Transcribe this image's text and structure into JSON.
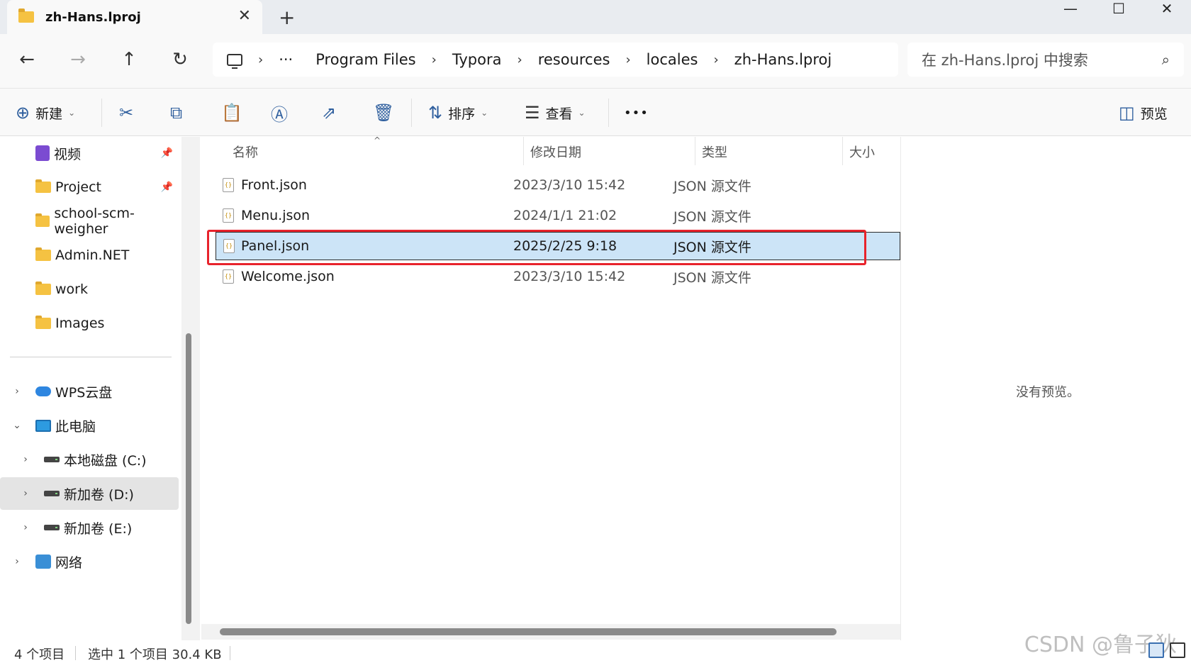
{
  "window": {
    "tab_title": "zh-Hans.lproj",
    "close_tab": "✕",
    "new_tab": "+",
    "minimize": "—",
    "maximize": "☐",
    "close": "✕"
  },
  "nav": {
    "back": "←",
    "forward": "→",
    "up": "↑",
    "refresh": "↻"
  },
  "address": {
    "ellipsis": "···",
    "segments": [
      "Program Files",
      "Typora",
      "resources",
      "locales",
      "zh-Hans.lproj"
    ],
    "separator": "›"
  },
  "search": {
    "placeholder": "在 zh-Hans.lproj 中搜索",
    "icon": "search-icon"
  },
  "toolbar": {
    "new_label": "新建",
    "sort_label": "排序",
    "view_label": "查看",
    "more": "•••",
    "preview_label": "预览"
  },
  "sidebar": {
    "quick": [
      {
        "label": "视频",
        "pinned": true
      },
      {
        "label": "Project",
        "pinned": true
      },
      {
        "label": "school-scm-weigher",
        "pinned": false
      },
      {
        "label": "Admin.NET",
        "pinned": false
      },
      {
        "label": "work",
        "pinned": false
      },
      {
        "label": "Images",
        "pinned": false
      }
    ],
    "tree": [
      {
        "label": "WPS云盘"
      },
      {
        "label": "此电脑"
      },
      {
        "label": "本地磁盘 (C:)"
      },
      {
        "label": "新加卷 (D:)"
      },
      {
        "label": "新加卷 (E:)"
      },
      {
        "label": "网络"
      }
    ]
  },
  "columns": {
    "name": "名称",
    "modified": "修改日期",
    "type": "类型",
    "size": "大小"
  },
  "files": [
    {
      "name": "Front.json",
      "modified": "2023/3/10 15:42",
      "type": "JSON 源文件"
    },
    {
      "name": "Menu.json",
      "modified": "2024/1/1 21:02",
      "type": "JSON 源文件"
    },
    {
      "name": "Panel.json",
      "modified": "2025/2/25 9:18",
      "type": "JSON 源文件",
      "selected": true
    },
    {
      "name": "Welcome.json",
      "modified": "2023/3/10 15:42",
      "type": "JSON 源文件"
    }
  ],
  "preview": {
    "empty_text": "没有预览。"
  },
  "status": {
    "item_count": "4 个项目",
    "selection": "选中 1 个项目  30.4 KB"
  },
  "watermark": "CSDN @鲁子狄",
  "colors": {
    "selection_bg": "#cce4f7",
    "highlight_border": "#e8232c",
    "folder": "#f5c242"
  }
}
